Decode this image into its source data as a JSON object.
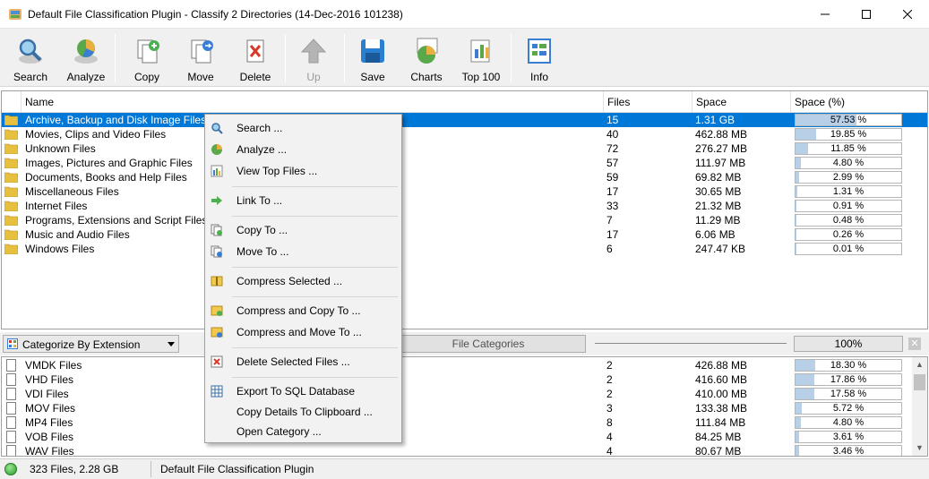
{
  "window": {
    "title": "Default File Classification Plugin - Classify 2 Directories (14-Dec-2016 101238)",
    "controls": [
      "minimize",
      "maximize",
      "close"
    ]
  },
  "toolbar": {
    "search": "Search",
    "analyze": "Analyze",
    "copy": "Copy",
    "move": "Move",
    "delete": "Delete",
    "up": "Up",
    "save": "Save",
    "charts": "Charts",
    "top100": "Top 100",
    "info": "Info"
  },
  "upper_table": {
    "headers": {
      "name": "Name",
      "files": "Files",
      "space": "Space",
      "space_pct": "Space (%)"
    },
    "rows": [
      {
        "name": "Archive, Backup and Disk Image Files",
        "files": "15",
        "space": "1.31 GB",
        "pct": "57.53 %",
        "fill": 0.5753,
        "selected": true
      },
      {
        "name": "Movies, Clips and Video Files",
        "files": "40",
        "space": "462.88 MB",
        "pct": "19.85 %",
        "fill": 0.1985
      },
      {
        "name": "Unknown Files",
        "files": "72",
        "space": "276.27 MB",
        "pct": "11.85 %",
        "fill": 0.1185
      },
      {
        "name": "Images, Pictures and Graphic Files",
        "files": "57",
        "space": "111.97 MB",
        "pct": "4.80 %",
        "fill": 0.048
      },
      {
        "name": "Documents, Books and Help Files",
        "files": "59",
        "space": "69.82 MB",
        "pct": "2.99 %",
        "fill": 0.0299
      },
      {
        "name": "Miscellaneous Files",
        "files": "17",
        "space": "30.65 MB",
        "pct": "1.31 %",
        "fill": 0.0131
      },
      {
        "name": "Internet Files",
        "files": "33",
        "space": "21.32 MB",
        "pct": "0.91 %",
        "fill": 0.0091
      },
      {
        "name": "Programs, Extensions and Script Files",
        "files": "7",
        "space": "11.29 MB",
        "pct": "0.48 %",
        "fill": 0.0048
      },
      {
        "name": "Music and Audio Files",
        "files": "17",
        "space": "6.06 MB",
        "pct": "0.26 %",
        "fill": 0.0026
      },
      {
        "name": "Windows Files",
        "files": "6",
        "space": "247.47 KB",
        "pct": "0.01 %",
        "fill": 0.0001
      }
    ]
  },
  "midbar": {
    "categorize": "Categorize By Extension",
    "file_categories": "File Categories",
    "zoom": "100%"
  },
  "lower_table": {
    "rows": [
      {
        "name": "VMDK Files",
        "files": "2",
        "space": "426.88 MB",
        "pct": "18.30 %",
        "fill": 0.183
      },
      {
        "name": "VHD Files",
        "files": "2",
        "space": "416.60 MB",
        "pct": "17.86 %",
        "fill": 0.1786
      },
      {
        "name": "VDI Files",
        "files": "2",
        "space": "410.00 MB",
        "pct": "17.58 %",
        "fill": 0.1758
      },
      {
        "name": "MOV Files",
        "files": "3",
        "space": "133.38 MB",
        "pct": "5.72 %",
        "fill": 0.0572
      },
      {
        "name": "MP4 Files",
        "files": "8",
        "space": "111.84 MB",
        "pct": "4.80 %",
        "fill": 0.048
      },
      {
        "name": "VOB Files",
        "files": "4",
        "space": "84.25 MB",
        "pct": "3.61 %",
        "fill": 0.0361
      },
      {
        "name": "WAV Files",
        "files": "4",
        "space": "80.67 MB",
        "pct": "3.46 %",
        "fill": 0.0346
      }
    ]
  },
  "status": {
    "summary": "323 Files, 2.28 GB",
    "plugin": "Default File Classification Plugin"
  },
  "context_menu": {
    "search": "Search ...",
    "analyze": "Analyze ...",
    "view_top": "View Top Files ...",
    "link_to": "Link To ...",
    "copy_to": "Copy To ...",
    "move_to": "Move To ...",
    "compress_selected": "Compress Selected ...",
    "compress_copy": "Compress and Copy To ...",
    "compress_move": "Compress and Move To ...",
    "delete_selected": "Delete Selected Files ...",
    "export_sql": "Export To SQL Database",
    "copy_details": "Copy Details To Clipboard ...",
    "open_category": "Open Category ..."
  }
}
